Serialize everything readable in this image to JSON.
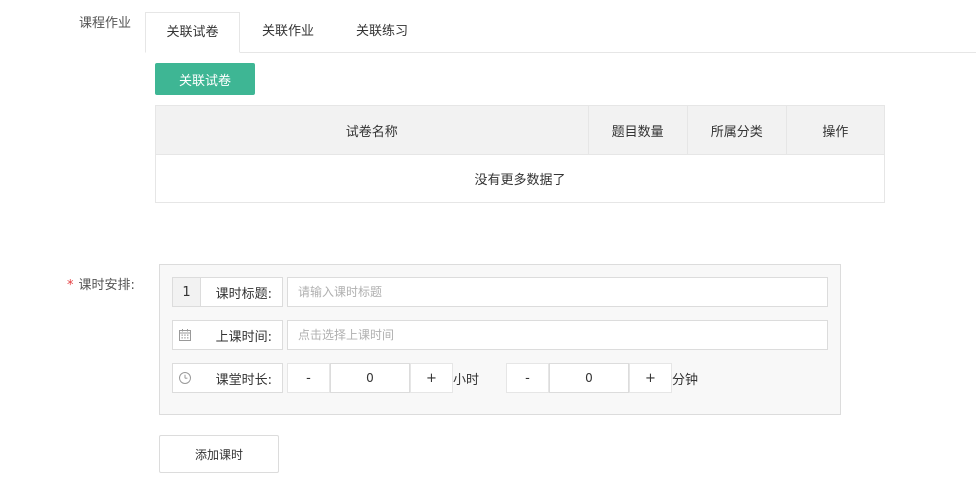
{
  "homework": {
    "label": "课程作业",
    "tabs": [
      {
        "label": "关联试卷",
        "active": true
      },
      {
        "label": "关联作业",
        "active": false
      },
      {
        "label": "关联练习",
        "active": false
      }
    ],
    "link_button": "关联试卷",
    "table": {
      "headers": [
        "试卷名称",
        "题目数量",
        "所属分类",
        "操作"
      ],
      "empty_text": "没有更多数据了"
    }
  },
  "schedule": {
    "required_mark": "*",
    "label": "课时安排:",
    "row_index": "1",
    "title_label": "课时标题:",
    "title_placeholder": "请输入课时标题",
    "time_label": "上课时间:",
    "time_placeholder": "点击选择上课时间",
    "duration_label": "课堂时长:",
    "hours": {
      "minus": "-",
      "value": "0",
      "plus": "+",
      "unit": "小时"
    },
    "minutes": {
      "minus": "-",
      "value": "0",
      "plus": "+",
      "unit": "分钟"
    },
    "add_button": "添加课时",
    "icons": {
      "time": "calendar-icon",
      "duration": "clock-icon"
    }
  },
  "colors": {
    "primary": "#3eb694",
    "required": "#e4393c"
  }
}
